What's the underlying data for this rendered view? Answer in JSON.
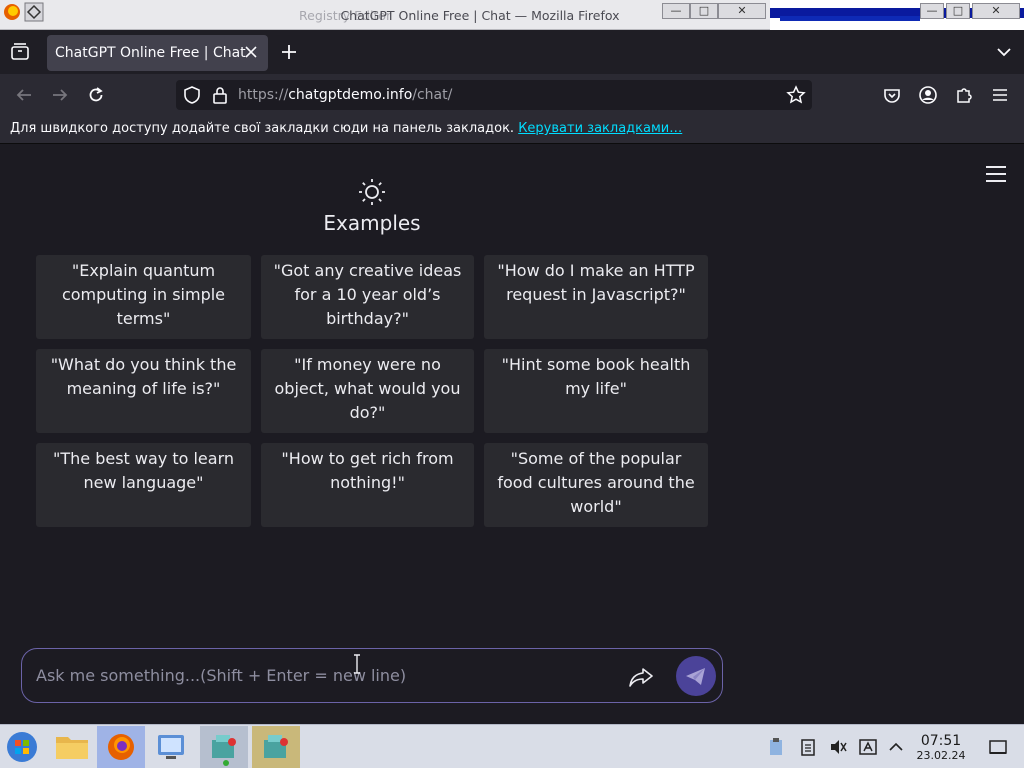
{
  "window": {
    "title": "ChatGPT Online Free | Chat — Mozilla Firefox",
    "ghost_title": "Registry Editor"
  },
  "tabs": [
    {
      "label": "ChatGPT Online Free | Chat",
      "active": true
    }
  ],
  "navbar": {
    "url_scheme": "https://",
    "url_host": "chatgptdemo.info",
    "url_path": "/chat/"
  },
  "bookmarks_bar": {
    "message": "Для швидкого доступу додайте свої закладки сюди на панель закладок.",
    "manage_link": "Керувати закладками…"
  },
  "page": {
    "examples_title": "Examples",
    "examples": [
      "\"Explain quantum computing in simple terms\"",
      "\"Got any creative ideas for a 10 year old’s birthday?\"",
      "\"How do I make an HTTP request in Javascript?\"",
      "\"What do you think the meaning of life is?\"",
      "\"If money were no object, what would you do?\"",
      "\"Hint some book health my life\"",
      "\"The best way to learn new language\"",
      "\"How to get rich from nothing!\"",
      "\"Some of the popular food cultures around the world\""
    ],
    "input_placeholder": "Ask me something...(Shift + Enter = new line)"
  },
  "taskbar": {
    "clock_time": "07:51",
    "clock_date": "23.02.24"
  },
  "colors": {
    "page_bg": "#1c1b22",
    "card_bg": "#2a2a2f",
    "accent": "#4b4399",
    "link": "#00ddff"
  }
}
